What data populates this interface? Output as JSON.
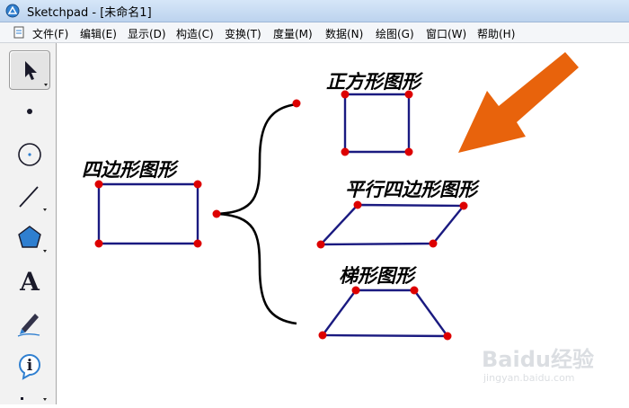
{
  "window": {
    "title": "Sketchpad - [未命名1]"
  },
  "menu": {
    "items": [
      {
        "label": "文件(F)",
        "name": "menu-file"
      },
      {
        "label": "编辑(E)",
        "name": "menu-edit"
      },
      {
        "label": "显示(D)",
        "name": "menu-display"
      },
      {
        "label": "构造(C)",
        "name": "menu-construct"
      },
      {
        "label": "变换(T)",
        "name": "menu-transform"
      },
      {
        "label": "度量(M)",
        "name": "menu-measure"
      },
      {
        "label": "数据(N)",
        "name": "menu-data"
      },
      {
        "label": "绘图(G)",
        "name": "menu-graph"
      },
      {
        "label": "窗口(W)",
        "name": "menu-window"
      },
      {
        "label": "帮助(H)",
        "name": "menu-help"
      }
    ]
  },
  "tools": {
    "items": [
      {
        "name": "arrow-select-tool",
        "icon": "arrow-pointer-icon"
      },
      {
        "name": "point-tool",
        "icon": "point-icon"
      },
      {
        "name": "compass-tool",
        "icon": "circle-icon"
      },
      {
        "name": "straightedge-tool",
        "icon": "line-segment-icon"
      },
      {
        "name": "polygon-tool",
        "icon": "pentagon-icon"
      },
      {
        "name": "text-tool",
        "icon": "text-a-icon",
        "glyph": "A"
      },
      {
        "name": "marker-tool",
        "icon": "marker-pen-icon"
      },
      {
        "name": "information-tool",
        "icon": "info-icon",
        "glyph": "i"
      },
      {
        "name": "custom-tool",
        "icon": "custom-tool-icon"
      }
    ]
  },
  "canvas": {
    "labels": {
      "quadrilateral": "四边形图形",
      "square": "正方形图形",
      "parallelogram": "平行四边形图形",
      "trapezoid": "梯形图形"
    },
    "colors": {
      "segment": "#1a1a80",
      "point": "#dd0000",
      "arrow": "#e8630c"
    }
  },
  "watermark": {
    "main": "Baidu经验",
    "sub": "jingyan.baidu.com"
  }
}
